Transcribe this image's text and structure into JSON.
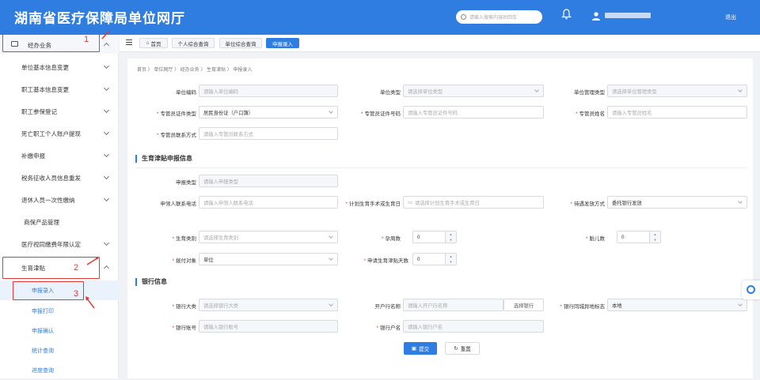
{
  "header": {
    "title": "湖南省医疗保障局单位网厅",
    "search_placeholder": "请输入搜索内容后回车",
    "logout": "退出"
  },
  "sidebar": {
    "items": [
      {
        "label": "经办业务"
      },
      {
        "label": "单位基本信息变更"
      },
      {
        "label": "职工基本信息变更"
      },
      {
        "label": "职工参保登记"
      },
      {
        "label": "死亡职工个人账户提现"
      },
      {
        "label": "补缴申报"
      },
      {
        "label": "税务征收人员信息重发"
      },
      {
        "label": "退休人员一次性缴纳"
      },
      {
        "label": "商保产品管理"
      },
      {
        "label": "医疗视同缴费年限认定"
      },
      {
        "label": "生育津贴"
      }
    ],
    "sub_items": [
      {
        "label": "申报录入"
      },
      {
        "label": "申报打印"
      },
      {
        "label": "申报确认"
      },
      {
        "label": "统计查询"
      },
      {
        "label": "进度查询"
      }
    ],
    "annotations": [
      "1",
      "2",
      "3"
    ]
  },
  "tabs": [
    {
      "label": "首页"
    },
    {
      "label": "个人综合查询"
    },
    {
      "label": "单位综合查询"
    },
    {
      "label": "申报录入"
    }
  ],
  "breadcrumb": "首页 〉 单位网厅 〉 经办业务 〉 生育津贴 〉 申报录入",
  "unit": {
    "code_label": "单位编码",
    "code_ph": "请输入单位编码",
    "type_label": "单位类型",
    "type_ph": "请选择单位类型",
    "mgmt_label": "单位管理类型",
    "mgmt_ph": "请选择单位管理类型",
    "idtype_label": "专管员证件类型",
    "idtype_val": "居民身份证（户口簿）",
    "idno_label": "专管员证件号码",
    "idno_ph": "请输入专管员证件号码",
    "name_label": "专管员姓名",
    "name_ph": "请输入专管员姓名",
    "contact_label": "专管员联系方式",
    "contact_ph": "请输入专管员联系方式"
  },
  "section1": {
    "title": "生育津贴申报信息",
    "decltype_label": "申报类型",
    "decltype_ph": "请输入申报类型",
    "phone_label": "申领人联系电话",
    "phone_ph": "请输入申领人联系电话",
    "date_label": "计划生育手术或生育日",
    "date_ph": "请选择计划生育手术或生育日",
    "pay_label": "待遇发放方式",
    "pay_val": "委托银行发放",
    "btype_label": "生育类别",
    "btype_ph": "请选择生育类别",
    "weeks_label": "孕周数",
    "weeks_val": "0",
    "fetus_label": "胎儿数",
    "fetus_val": "0",
    "target_label": "拨付对象",
    "target_val": "单位",
    "days_label": "申请生育津贴天数",
    "days_val": "0"
  },
  "section2": {
    "title": "银行信息",
    "bank_label": "银行大类",
    "bank_ph": "请选择银行大类",
    "branch_label": "开户行名称",
    "branch_ph": "请输入开户行名称",
    "branch_btn": "选择银行",
    "flag_label": "银行同城异地标志",
    "flag_val": "本地",
    "acct_label": "银行账号",
    "acct_ph": "请输入银行账号",
    "holder_label": "银行户名",
    "holder_ph": "请输入银行户名"
  },
  "actions": {
    "submit": "提交",
    "reset": "重置"
  }
}
